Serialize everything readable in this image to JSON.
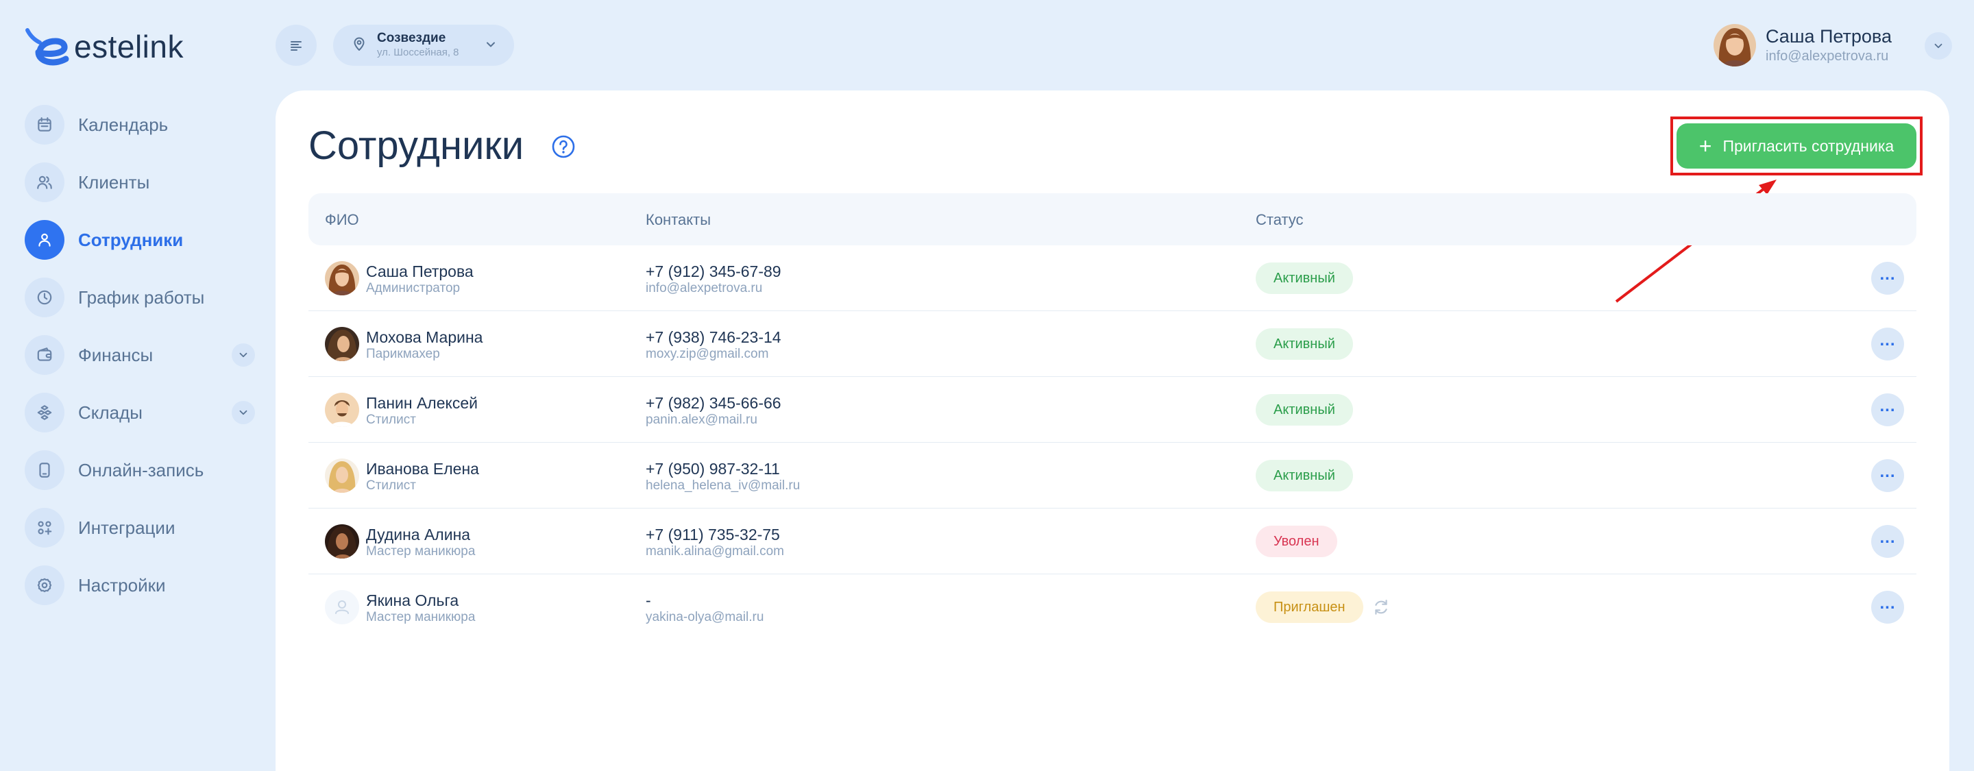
{
  "brand": {
    "name": "estelink",
    "logo_letter": "e"
  },
  "sidebar": {
    "items": [
      {
        "label": "Календарь",
        "icon": "calendar-icon",
        "active": false
      },
      {
        "label": "Клиенты",
        "icon": "clients-icon",
        "active": false
      },
      {
        "label": "Сотрудники",
        "icon": "employee-icon",
        "active": true
      },
      {
        "label": "График работы",
        "icon": "clock-icon",
        "active": false
      },
      {
        "label": "Финансы",
        "icon": "wallet-icon",
        "active": false,
        "expandable": true
      },
      {
        "label": "Склады",
        "icon": "boxes-icon",
        "active": false,
        "expandable": true
      },
      {
        "label": "Онлайн-запись",
        "icon": "phone-icon",
        "active": false
      },
      {
        "label": "Интеграции",
        "icon": "integrations-icon",
        "active": false
      },
      {
        "label": "Настройки",
        "icon": "gear-icon",
        "active": false
      }
    ]
  },
  "header": {
    "location": {
      "name": "Созвездие",
      "address": "ул. Шоссейная, 8"
    },
    "user": {
      "name": "Саша Петрова",
      "email": "info@alexpetrova.ru"
    }
  },
  "main": {
    "title": "Сотрудники",
    "invite_button": {
      "label": "Пригласить сотрудника"
    },
    "table": {
      "columns": {
        "name": "ФИО",
        "contacts": "Контакты",
        "status": "Статус"
      },
      "rows": [
        {
          "name": "Саша Петрова",
          "role": "Администратор",
          "phone": "+7 (912) 345-67-89",
          "email": "info@alexpetrova.ru",
          "status": "Активный",
          "status_type": "active"
        },
        {
          "name": "Мохова Марина",
          "role": "Парикмахер",
          "phone": "+7 (938) 746-23-14",
          "email": "moxy.zip@gmail.com",
          "status": "Активный",
          "status_type": "active"
        },
        {
          "name": "Панин Алексей",
          "role": "Стилист",
          "phone": "+7 (982) 345-66-66",
          "email": "panin.alex@mail.ru",
          "status": "Активный",
          "status_type": "active"
        },
        {
          "name": "Иванова Елена",
          "role": "Стилист",
          "phone": "+7 (950) 987-32-11",
          "email": "helena_helena_iv@mail.ru",
          "status": "Активный",
          "status_type": "active"
        },
        {
          "name": "Дудина Алина",
          "role": "Мастер маникюра",
          "phone": "+7 (911) 735-32-75",
          "email": "manik.alina@gmail.com",
          "status": "Уволен",
          "status_type": "fired"
        },
        {
          "name": "Якина Ольга",
          "role": "Мастер маникюра",
          "phone": "-",
          "email": "yakina-olya@mail.ru",
          "status": "Приглашен",
          "status_type": "invited"
        }
      ]
    }
  },
  "colors": {
    "background": "#e4effb",
    "accent": "#2f73f0",
    "primary_button": "#4cc46a",
    "status_active": "#2a9d4a",
    "status_fired": "#d83552",
    "status_invited": "#c79014",
    "annotation": "#e31b1b"
  }
}
